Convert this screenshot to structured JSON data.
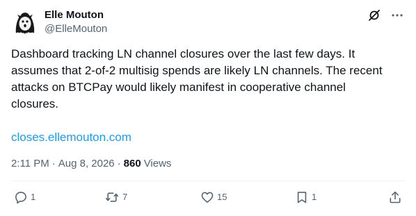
{
  "author": {
    "name": "Elle Mouton",
    "handle": "@ElleMouton",
    "avatar_icon": "ghost-avatar-icon"
  },
  "header_icons": [
    "grok-icon",
    "more-options-icon"
  ],
  "tweet": {
    "text": "Dashboard tracking LN channel closures over the last few days. It\nassumes that 2-of-2 multisig spends are likely LN channels. The recent\nattacks on BTCPay would likely manifest in cooperative channel\nclosures.",
    "link": "closes.ellemouton.com",
    "time": "2:11 PM",
    "separator": "·",
    "date": "Aug 8, 2026",
    "views_count": "860",
    "views_label": "Views"
  },
  "actions": {
    "replies": "1",
    "reposts": "7",
    "likes": "15",
    "bookmarks": "1"
  },
  "colors": {
    "text": "#0f1419",
    "secondary": "#536471",
    "link": "#1d9bf0",
    "divider": "#eff3f4"
  }
}
